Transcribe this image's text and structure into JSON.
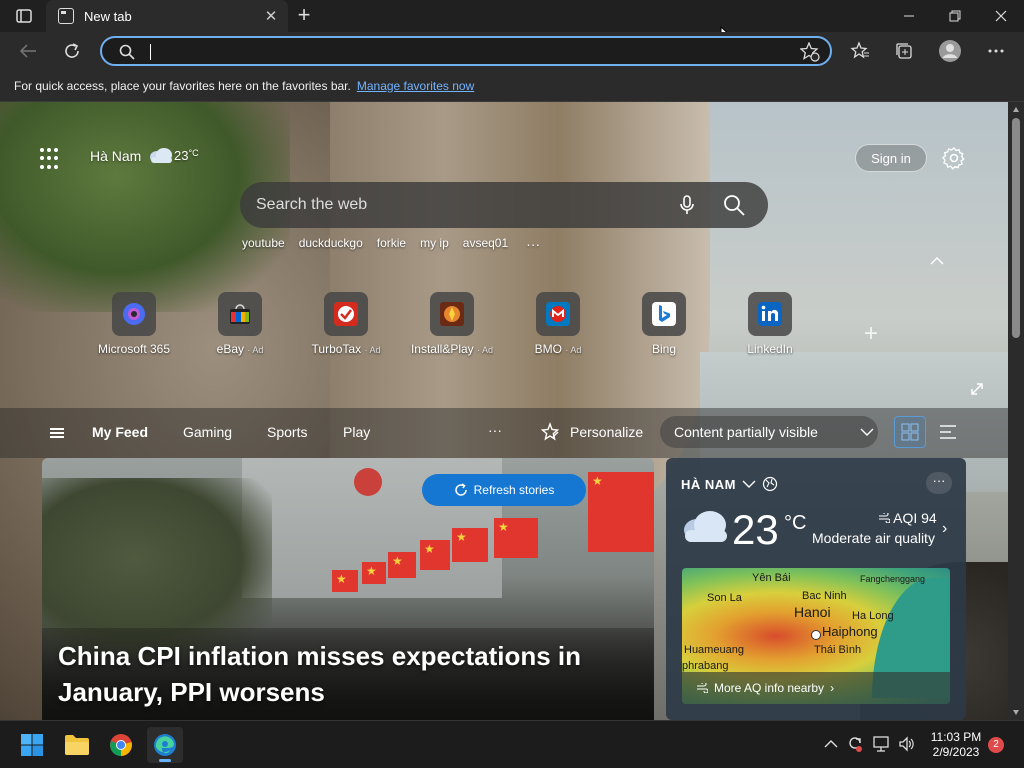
{
  "browser": {
    "tab_title": "New tab",
    "tab_close": "✕",
    "new_tab": "+",
    "address_value": "",
    "favorites_hint": "For quick access, place your favorites here on the favorites bar.",
    "favorites_link": "Manage favorites now"
  },
  "ntp": {
    "location": "Hà Nam",
    "temperature": "23",
    "temp_unit": "°C",
    "sign_in": "Sign in",
    "search_placeholder": "Search the web",
    "suggestions": [
      "youtube",
      "duckduckgo",
      "forkie",
      "my ip",
      "avseq01"
    ],
    "suggestions_more": "···",
    "quick_links": [
      {
        "label": "Microsoft 365",
        "ad": "",
        "icon": "microsoft-365-icon",
        "color": "#5b4fe0",
        "glyph": "◉"
      },
      {
        "label": "eBay",
        "ad": "· Ad",
        "icon": "ebay-icon",
        "color": "#222222",
        "glyph": "■"
      },
      {
        "label": "TurboTax",
        "ad": "· Ad",
        "icon": "turbotax-icon",
        "color": "#d52b1e",
        "glyph": "✓"
      },
      {
        "label": "Install&Play",
        "ad": "· Ad",
        "icon": "install-play-icon",
        "color": "#8a3a1e",
        "glyph": "✦"
      },
      {
        "label": "BMO",
        "ad": "· Ad",
        "icon": "bmo-icon",
        "color": "#0079c1",
        "glyph": "M"
      },
      {
        "label": "Bing",
        "ad": "",
        "icon": "bing-icon",
        "color": "#ffffff",
        "glyph": "b"
      },
      {
        "label": "LinkedIn",
        "ad": "",
        "icon": "linkedin-icon",
        "color": "#0a66c2",
        "glyph": "in"
      }
    ],
    "add_link": "+"
  },
  "feed": {
    "tabs": [
      "My Feed",
      "Gaming",
      "Sports",
      "Play"
    ],
    "more": "···",
    "personalize": "Personalize",
    "visibility": "Content partially visible",
    "refresh": "Refresh stories",
    "headline": "China CPI inflation misses expectations in January, PPI worsens"
  },
  "weather_card": {
    "place": "HÀ NAM",
    "temperature": "23",
    "unit": "°C",
    "aqi": "AQI 94",
    "aqi_desc": "Moderate air quality",
    "more": "···",
    "map_labels": [
      "Yên Bái",
      "Bac Ninh",
      "Fangchenggang",
      "Son La",
      "Hanoi",
      "Ha Long",
      "Haiphong",
      "Huameuang",
      "Thái Bình",
      "phrabang"
    ],
    "map_link": "More AQ info nearby"
  },
  "taskbar": {
    "time": "11:03 PM",
    "date": "2/9/2023",
    "notifications": "2"
  },
  "colors": {
    "accent": "#1677d2",
    "omnibox_border": "#6fb0f0",
    "link": "#74b3ff"
  }
}
